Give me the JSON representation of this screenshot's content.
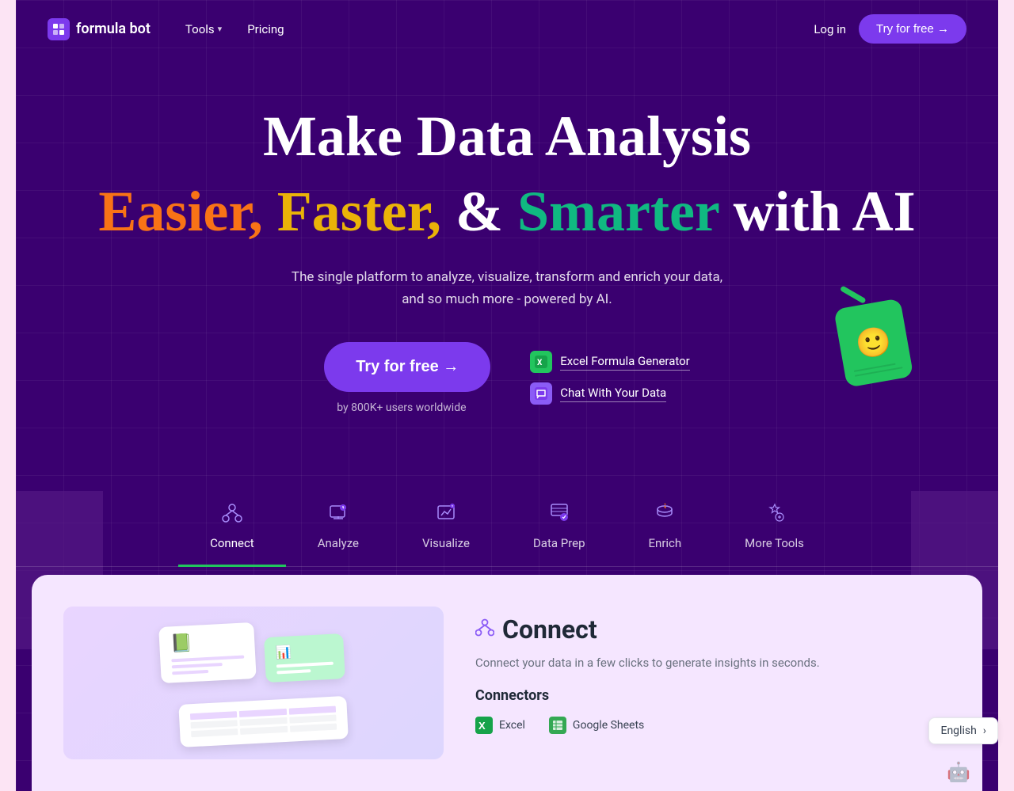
{
  "meta": {
    "lang": "English"
  },
  "nav": {
    "logo_text": "formula bot",
    "tools_label": "Tools",
    "pricing_label": "Pricing",
    "login_label": "Log in",
    "try_free_label": "Try for free →"
  },
  "hero": {
    "title_line1": "Make Data Analysis",
    "title_line2_part1": "Easier,",
    "title_line2_part2": "Faster,",
    "title_line2_part3": "& ",
    "title_line2_part4": "Smarter",
    "title_line2_part5": " with AI",
    "description": "The single platform to analyze, visualize, transform and enrich your data, and so much more - powered by AI.",
    "cta_button": "Try for free →",
    "users_text": "by 800K+ users worldwide",
    "quick_link_1": "Excel Formula Generator",
    "quick_link_2": "Chat With Your Data"
  },
  "tabs": [
    {
      "id": "connect",
      "label": "Connect",
      "icon": "⬡",
      "active": true
    },
    {
      "id": "analyze",
      "label": "Analyze",
      "icon": "💬"
    },
    {
      "id": "visualize",
      "label": "Visualize",
      "icon": "⊞"
    },
    {
      "id": "data-prep",
      "label": "Data Prep",
      "icon": "⚙"
    },
    {
      "id": "enrich",
      "label": "Enrich",
      "icon": "🗄"
    },
    {
      "id": "more-tools",
      "label": "More Tools",
      "icon": "✦"
    }
  ],
  "connect_section": {
    "icon": "⬡",
    "title": "Connect",
    "description": "Connect your data in a few clicks to generate insights in seconds.",
    "connectors_label": "Connectors",
    "connectors": [
      {
        "name": "Excel",
        "icon": "📗"
      },
      {
        "name": "Google Sheets",
        "icon": "📊"
      }
    ]
  },
  "colors": {
    "bg_dark": "#3a0070",
    "bg_body": "#fce4f4",
    "accent_purple": "#7c3aed",
    "accent_green": "#22c55e",
    "text_orange": "#f97316",
    "text_yellow": "#eab308",
    "text_teal": "#10b981"
  }
}
